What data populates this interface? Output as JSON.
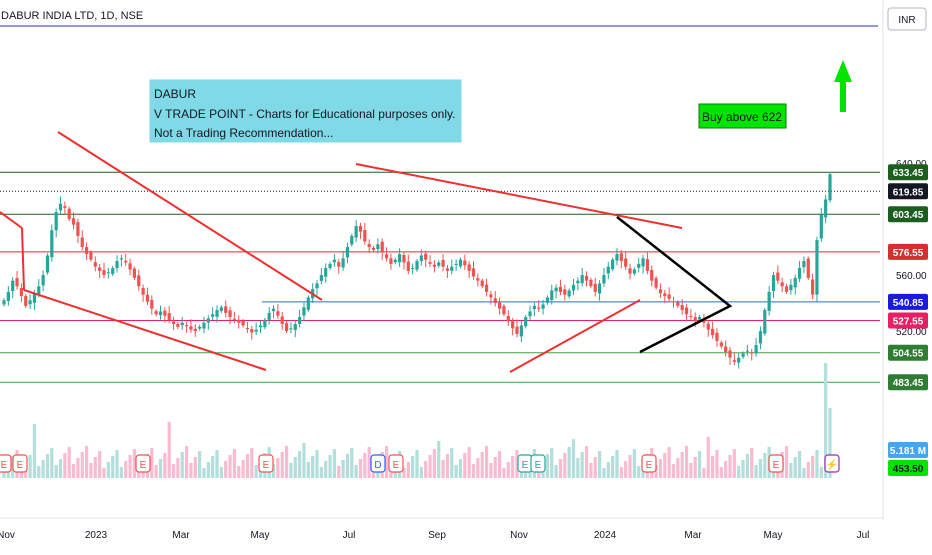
{
  "chart_data": {
    "type": "candlestick",
    "title": "DABUR INDIA LTD, 1D, NSE",
    "currency": "INR",
    "y_axis_ticks": [
      640,
      620,
      600,
      580,
      560,
      540,
      520,
      500,
      480
    ],
    "y_axis_tick_labels": [
      "640.00",
      "",
      "",
      "",
      "560.00",
      "",
      "520.00",
      "",
      ""
    ],
    "ylim": [
      455,
      654
    ],
    "x_axis_ticks": [
      "Nov",
      "2023",
      "Mar",
      "May",
      "Jul",
      "Sep",
      "Nov",
      "2024",
      "Mar",
      "May",
      "Jul"
    ],
    "annotation_box": {
      "lines": [
        "DABUR",
        "V TRADE POINT - Charts for Educational purposes only.",
        "Not a Trading Recommendation..."
      ],
      "background": "#7fd9e6"
    },
    "callout": {
      "text": "Buy above 622",
      "background": "#00e400"
    },
    "levels": [
      {
        "price": 633.45,
        "label": "633.45",
        "color": "#1b5e20",
        "style": "solid",
        "tag_bg": "#1b5e20"
      },
      {
        "price": 619.85,
        "label": "619.85",
        "color": "#131722",
        "style": "dotted",
        "tag_bg": "#131722"
      },
      {
        "price": 603.45,
        "label": "603.45",
        "color": "#1b5e20",
        "style": "solid",
        "tag_bg": "#1b5e20"
      },
      {
        "price": 576.55,
        "label": "576.55",
        "color": "#d32f2f",
        "style": "solid",
        "tag_bg": "#d32f2f"
      },
      {
        "price": 540.85,
        "label": "540.85",
        "color": "#2962ff",
        "style": "solid",
        "tag_bg": "#1a1adb"
      },
      {
        "price": 527.55,
        "label": "527.55",
        "color": "#e91e63",
        "style": "solid",
        "tag_bg": "#e91e63"
      },
      {
        "price": 504.55,
        "label": "504.55",
        "color": "#43a047",
        "style": "solid",
        "tag_bg": "#2e7d32"
      },
      {
        "price": 483.45,
        "label": "483.45",
        "color": "#43a047",
        "style": "solid",
        "tag_bg": "#2e7d32"
      }
    ],
    "volume_tags": [
      {
        "label": "5.181 M",
        "bg": "#42a5f5"
      },
      {
        "label": "453.50",
        "bg": "#00e400"
      }
    ],
    "event_markers": [
      "E",
      "E",
      "E",
      "E",
      "E",
      "D",
      "E",
      "E",
      "E",
      "E",
      "E",
      "E",
      "E",
      "E",
      "⚡"
    ],
    "series": [
      {
        "name": "DABUR",
        "close": [
          542,
          548,
          556,
          552,
          545,
          538,
          542,
          547,
          552,
          560,
          574,
          592,
          605,
          611,
          608,
          600,
          596,
          588,
          580,
          575,
          571,
          566,
          563,
          560,
          562,
          565,
          570,
          572,
          569,
          564,
          558,
          552,
          546,
          541,
          536,
          532,
          534,
          531,
          528,
          525,
          523,
          526,
          524,
          521,
          520,
          523,
          526,
          529,
          532,
          535,
          537,
          533,
          530,
          528,
          526,
          524,
          522,
          519,
          521,
          524,
          528,
          533,
          536,
          531,
          525,
          520,
          522,
          525,
          530,
          537,
          544,
          550,
          554,
          560,
          565,
          568,
          571,
          566,
          572,
          580,
          588,
          595,
          591,
          584,
          580,
          578,
          582,
          576,
          572,
          568,
          571,
          575,
          569,
          563,
          565,
          570,
          574,
          571,
          568,
          566,
          569,
          566,
          563,
          566,
          568,
          571,
          567,
          563,
          559,
          556,
          552,
          548,
          544,
          540,
          536,
          532,
          527,
          522,
          518,
          524,
          530,
          534,
          538,
          536,
          539,
          544,
          549,
          551,
          548,
          546,
          549,
          553,
          556,
          560,
          556,
          552,
          548,
          554,
          560,
          566,
          571,
          575,
          570,
          566,
          561,
          564,
          568,
          572,
          563,
          556,
          551,
          547,
          545,
          543,
          541,
          538,
          535,
          532,
          530,
          527,
          530,
          526,
          521,
          517,
          513,
          509,
          505,
          501,
          498,
          501,
          504,
          506,
          504,
          510,
          520,
          535,
          548,
          560,
          556,
          552,
          548,
          553,
          558,
          565,
          570,
          558,
          546,
          585,
          603,
          614,
          632
        ]
      }
    ],
    "xlabel": "",
    "ylabel": "",
    "grid": false
  }
}
